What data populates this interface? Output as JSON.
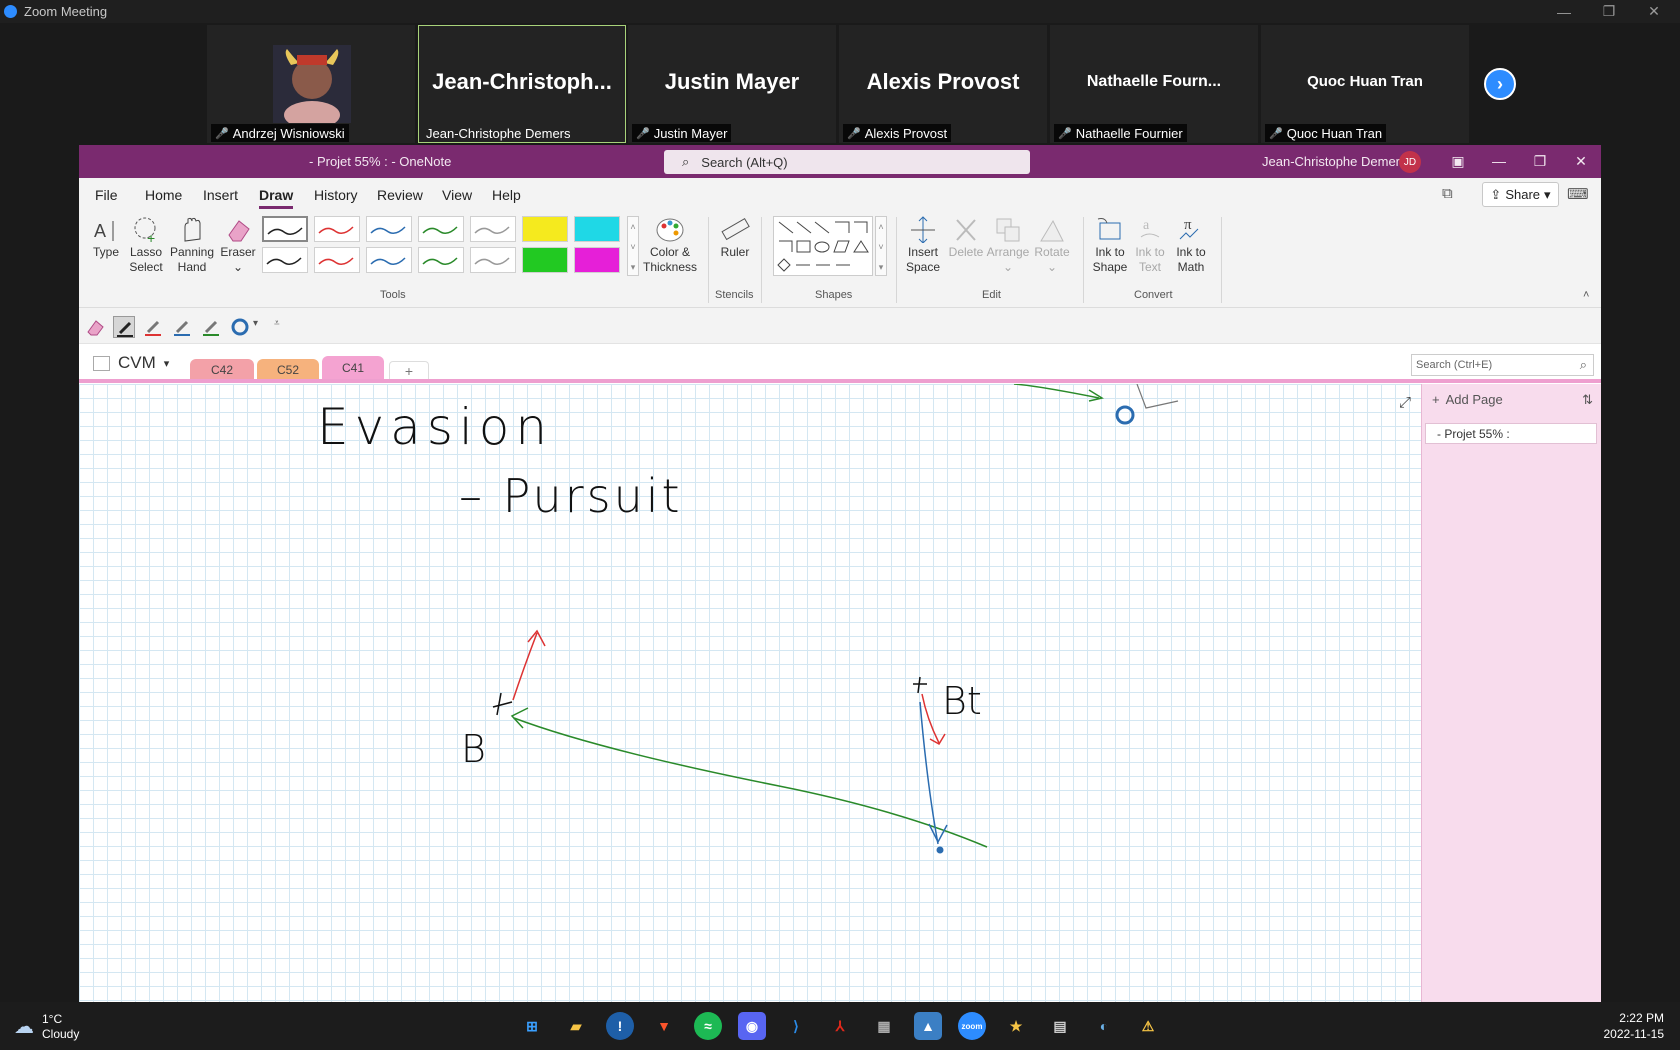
{
  "zoom": {
    "title": "Zoom Meeting",
    "participants": [
      {
        "big": "",
        "name": "Andrzej Wisniowski"
      },
      {
        "big": "Jean-Christoph...",
        "name": "Jean-Christophe Demers"
      },
      {
        "big": "Justin Mayer",
        "name": "Justin Mayer"
      },
      {
        "big": "Alexis Provost",
        "name": "Alexis Provost"
      },
      {
        "big": "Nathaelle  Fourn...",
        "name": "Nathaelle Fournier"
      },
      {
        "big": "Quoc Huan Tran",
        "name": "Quoc Huan Tran"
      }
    ]
  },
  "onenote": {
    "doc_title": "- Projet 55% :  -  OneNote",
    "search_placeholder": "Search (Alt+Q)",
    "user": "Jean-Christophe Demers",
    "user_initials": "JD",
    "menu": [
      "File",
      "Home",
      "Insert",
      "Draw",
      "History",
      "Review",
      "View",
      "Help"
    ],
    "share": "Share",
    "ribbon": {
      "type": "Type",
      "lasso": [
        "Lasso",
        "Select"
      ],
      "panning": [
        "Panning",
        "Hand"
      ],
      "eraser": "Eraser",
      "color_thickness": [
        "Color &",
        "Thickness"
      ],
      "ruler": "Ruler",
      "insert_space": [
        "Insert",
        "Space"
      ],
      "delete": "Delete",
      "arrange": "Arrange",
      "rotate": "Rotate",
      "ink_to_shape": [
        "Ink to",
        "Shape"
      ],
      "ink_to_text": [
        "Ink to",
        "Text"
      ],
      "ink_to_math": [
        "Ink to",
        "Math"
      ],
      "groups": [
        "Tools",
        "Stencils",
        "Shapes",
        "Edit",
        "Convert"
      ]
    },
    "notebook": "CVM",
    "sections": [
      "C42",
      "C52",
      "C41"
    ],
    "page_search_placeholder": "Search (Ctrl+E)",
    "add_page": "Add Page",
    "page": "- Projet 55% :",
    "ink_text": [
      "Evasion",
      "– Pursuit",
      "B",
      "Bt"
    ]
  },
  "taskbar": {
    "temp": "1°C",
    "weather": "Cloudy",
    "time": "2:22 PM",
    "date": "2022-11-15"
  },
  "colors": {
    "onenote_purple": "#7a2a6f",
    "zoom_blue": "#2d8cff",
    "section_pink": "#ee9fcf"
  }
}
